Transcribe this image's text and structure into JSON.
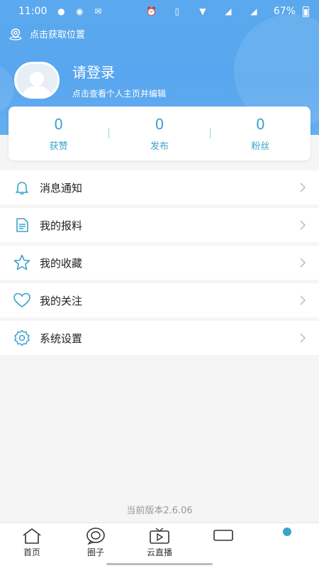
{
  "status_bar": {
    "time": "11:00",
    "battery": "67%"
  },
  "location": {
    "label": "点击获取位置"
  },
  "profile": {
    "title": "请登录",
    "subtitle": "点击查看个人主页并编辑"
  },
  "stats": [
    {
      "value": "0",
      "label": "获赞"
    },
    {
      "value": "0",
      "label": "发布"
    },
    {
      "value": "0",
      "label": "粉丝"
    }
  ],
  "menu": [
    {
      "label": "消息通知",
      "icon": "bell-icon"
    },
    {
      "label": "我的报料",
      "icon": "document-icon"
    },
    {
      "label": "我的收藏",
      "icon": "star-icon"
    },
    {
      "label": "我的关注",
      "icon": "heart-icon"
    },
    {
      "label": "系统设置",
      "icon": "gear-icon"
    }
  ],
  "version": "当前版本2.6.06",
  "tabs": [
    {
      "label": "首页",
      "icon": "home-icon"
    },
    {
      "label": "圈子",
      "icon": "chat-icon"
    },
    {
      "label": "云直播",
      "icon": "tv-icon"
    }
  ],
  "colors": {
    "accent": "#3aa3c9",
    "header": "#5aa9ee"
  }
}
